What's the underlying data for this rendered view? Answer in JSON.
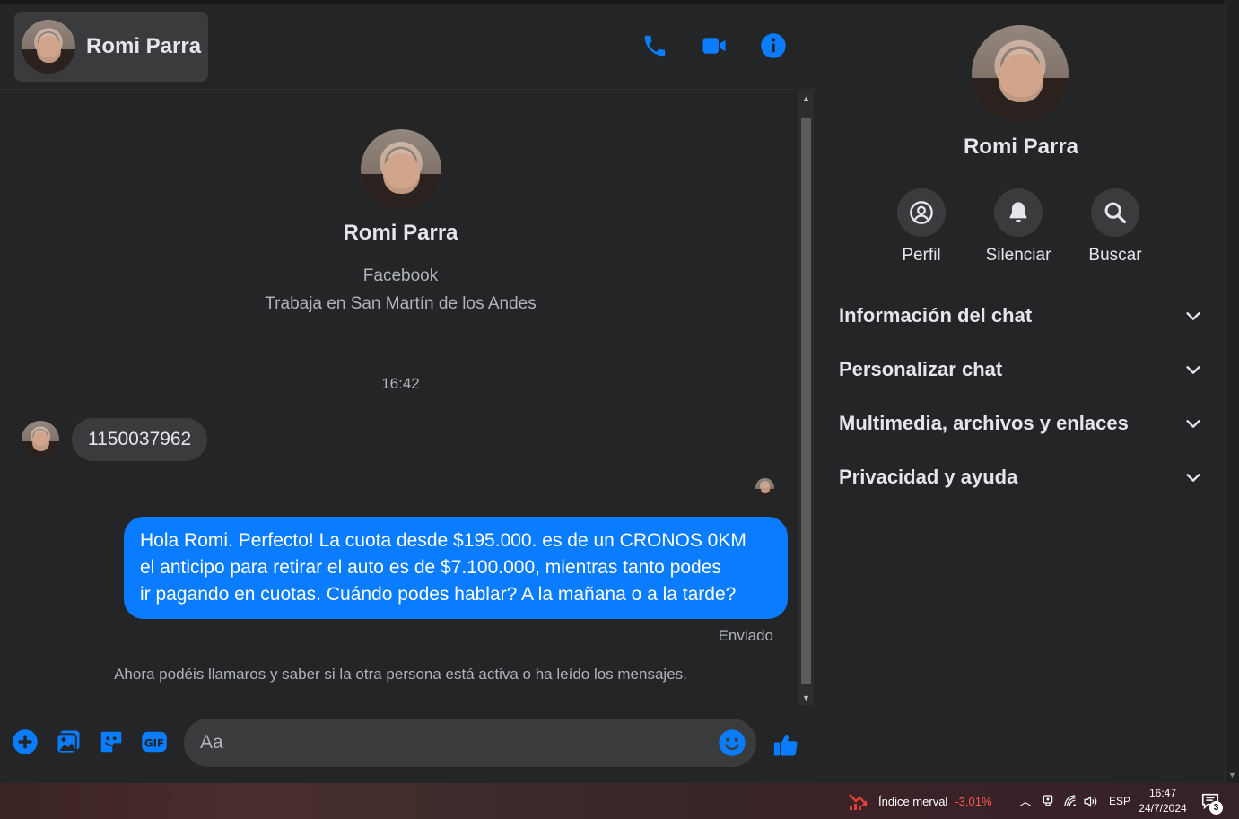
{
  "contact": {
    "name": "Romi Parra",
    "source": "Facebook",
    "work": "Trabaja en San Martín de los Andes"
  },
  "header": {
    "icons": [
      "phone-icon",
      "video-camera-icon",
      "info-icon"
    ]
  },
  "conversation": {
    "timestamp": "16:42",
    "incoming": [
      {
        "text": "1150037962"
      }
    ],
    "outgoing": [
      {
        "lines": [
          "Hola Romi. Perfecto! La cuota desde $195.000. es de un CRONOS 0KM",
          "el anticipo para retirar el auto es de $7.100.000, mientras tanto podes",
          "ir pagando en cuotas. Cuándo podes hablar? A la mañana o a la tarde?"
        ],
        "status": "Enviado"
      }
    ],
    "notice": "Ahora podéis llamaros y saber si la otra persona está activa o ha leído los mensajes."
  },
  "composer": {
    "placeholder": "Aa",
    "icons": [
      "plus-circle-icon",
      "photo-icon",
      "sticker-icon",
      "gif-icon",
      "emoji-icon",
      "thumbs-up-icon"
    ]
  },
  "info_panel": {
    "actions": [
      {
        "label": "Perfil",
        "icon": "profile-icon"
      },
      {
        "label": "Silenciar",
        "icon": "bell-icon"
      },
      {
        "label": "Buscar",
        "icon": "search-icon"
      }
    ],
    "sections": [
      {
        "title": "Información del chat"
      },
      {
        "title": "Personalizar chat"
      },
      {
        "title": "Multimedia, archivos y enlaces"
      },
      {
        "title": "Privacidad y ayuda"
      }
    ]
  },
  "taskbar": {
    "widget_label": "Índice merval",
    "widget_value": "-3,01%",
    "language": "ESP",
    "time": "16:47",
    "date": "24/7/2024",
    "notifications": "3"
  },
  "colors": {
    "accent": "#0a7cff",
    "background": "#242526",
    "surface": "#3a3b3c",
    "text_primary": "#e4e6eb",
    "text_secondary": "#b0b3b8"
  }
}
